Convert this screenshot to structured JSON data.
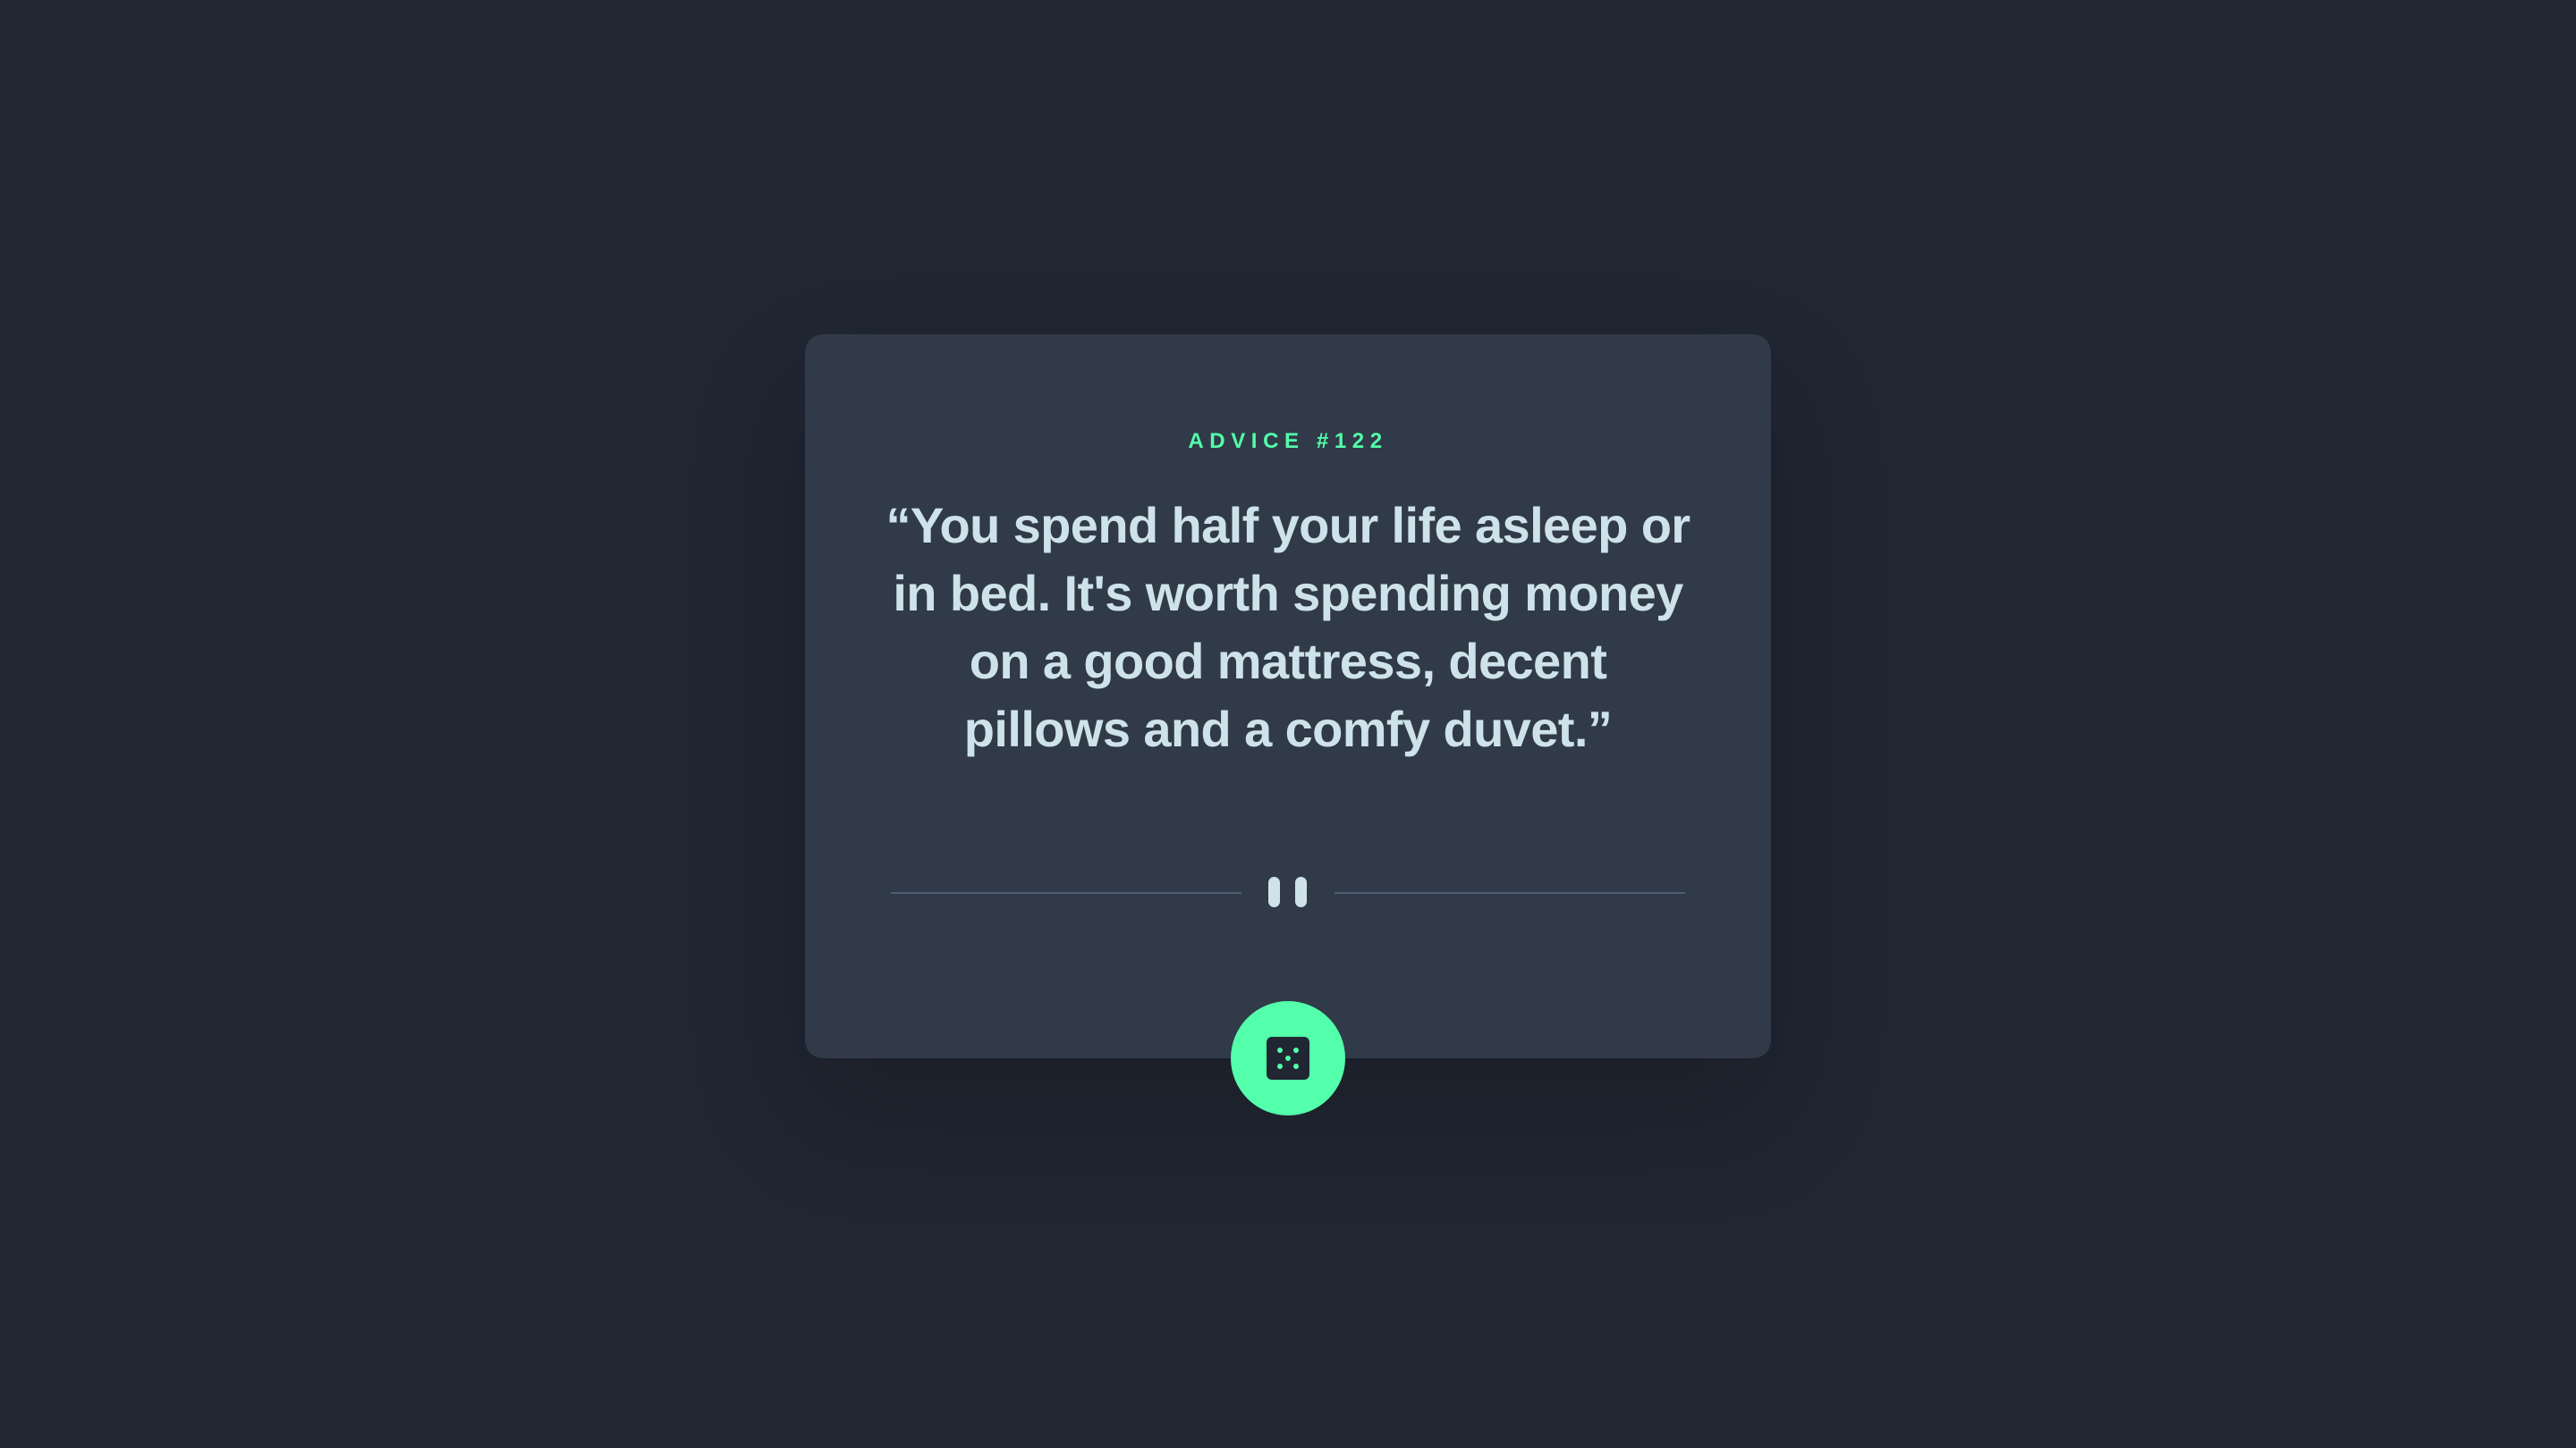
{
  "advice": {
    "id_label": "ADVICE #122",
    "quote": "“You spend half your life asleep or in bed. It's worth spending money on a good mattress, decent pillows and a comfy duvet.”"
  },
  "icons": {
    "divider": "pause-icon",
    "button": "dice-icon"
  },
  "colors": {
    "background": "#202632",
    "card": "#313a48",
    "accent": "#53ffaa",
    "text": "#cee3e9",
    "divider": "#4f5d74"
  }
}
